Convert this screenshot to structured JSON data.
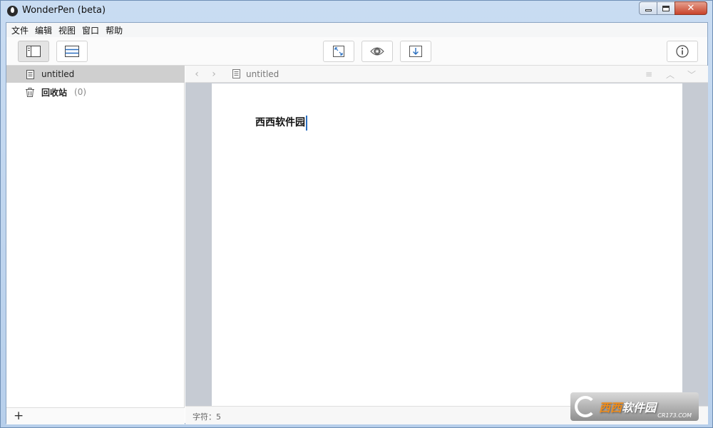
{
  "window": {
    "title": "WonderPen (beta)"
  },
  "menu": [
    "文件",
    "编辑",
    "视图",
    "窗口",
    "帮助"
  ],
  "toolbar": {
    "buttons": [
      "sidebar-layout-icon",
      "outline-layout-icon",
      "fullscreen-icon",
      "preview-eye-icon",
      "export-icon",
      "info-icon"
    ]
  },
  "sidebar": {
    "items": [
      {
        "label": "untitled",
        "icon": "document-icon",
        "selected": true
      },
      {
        "label": "回收站",
        "count": "(0)",
        "icon": "trash-icon"
      }
    ],
    "add_label": "+"
  },
  "editor": {
    "doc_title": "untitled",
    "content": "西西软件园"
  },
  "status": {
    "text": "字符：5"
  },
  "watermark": {
    "main_a": "西西",
    "main_b": "软件园",
    "sub": "CR173.COM"
  }
}
